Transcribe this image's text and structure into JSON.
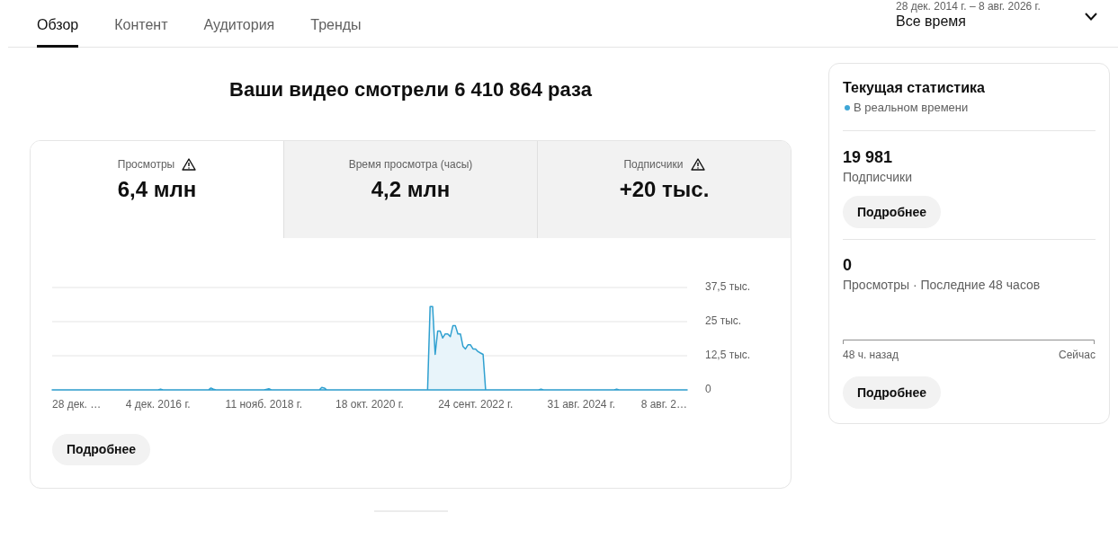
{
  "tabs": [
    {
      "label": "Обзор",
      "selected": true
    },
    {
      "label": "Контент",
      "selected": false
    },
    {
      "label": "Аудитория",
      "selected": false
    },
    {
      "label": "Тренды",
      "selected": false
    }
  ],
  "date_range": {
    "range": "28 дек. 2014 г. – 8 авг. 2026 г.",
    "period": "Все время"
  },
  "headline": "Ваши видео смотрели 6 410 864 раза",
  "overview_card": {
    "metrics": [
      {
        "label": "Просмотры",
        "value": "6,4 млн",
        "warning": true,
        "selected": true
      },
      {
        "label": "Время просмотра (часы)",
        "value": "4,2 млн",
        "warning": false,
        "selected": false
      },
      {
        "label": "Подписчики",
        "value": "+20 тыс.",
        "warning": true,
        "selected": false
      }
    ],
    "chart_data": {
      "type": "area",
      "categories": [
        "28 дек. …",
        null,
        null,
        null,
        null,
        null,
        null,
        null,
        null,
        null,
        null,
        null,
        null,
        null,
        null,
        null,
        null,
        null,
        null,
        null,
        null,
        null,
        null,
        null,
        null,
        null,
        null,
        null,
        null,
        null,
        null,
        null,
        null,
        null,
        null,
        null,
        null,
        null,
        null,
        null,
        null,
        null,
        "4 дек. 2016 г.",
        null,
        null,
        null,
        null,
        null,
        null,
        null,
        null,
        null,
        null,
        null,
        null,
        null,
        null,
        null,
        null,
        null,
        null,
        null,
        null,
        null,
        null,
        null,
        null,
        null,
        null,
        null,
        null,
        null,
        null,
        null,
        null,
        null,
        null,
        null,
        null,
        null,
        null,
        null,
        null,
        null,
        "11 нояб. 2018 г.",
        null,
        null,
        null,
        null,
        null,
        null,
        null,
        null,
        null,
        null,
        null,
        null,
        null,
        null,
        null,
        null,
        null,
        null,
        null,
        null,
        null,
        null,
        null,
        null,
        null,
        null,
        null,
        null,
        null,
        null,
        null,
        null,
        null,
        null,
        null,
        null,
        null,
        null,
        null,
        null,
        null,
        "18 окт. 2020 г.",
        null,
        null,
        null,
        null,
        null,
        null,
        null,
        null,
        null,
        null,
        null,
        null,
        null,
        null,
        null,
        null,
        null,
        null,
        null,
        null,
        null,
        null,
        null,
        null,
        null,
        null,
        null,
        null,
        null,
        null,
        null,
        null,
        null,
        null,
        null,
        null,
        null,
        null,
        null,
        null,
        null,
        "24 сент. 2022 г.",
        null,
        null,
        null,
        null,
        null,
        null,
        null,
        null,
        null,
        null,
        null,
        null,
        null,
        null,
        null,
        null,
        null,
        null,
        null,
        null,
        null,
        null,
        null,
        null,
        null,
        null,
        null,
        null,
        null,
        null,
        null,
        null,
        null,
        null,
        null,
        null,
        null,
        null,
        null,
        null,
        null,
        "31 авг. 2024 г.",
        null,
        null,
        null,
        null,
        null,
        null,
        null,
        null,
        null,
        null,
        null,
        null,
        null,
        null,
        null,
        null,
        null,
        null,
        null,
        null,
        null,
        null,
        null,
        null,
        null,
        null,
        null,
        null,
        null,
        null,
        null,
        null,
        null,
        null,
        null,
        null,
        null,
        null,
        null,
        null,
        null,
        "8 авг. 2…"
      ],
      "values": [
        0,
        0,
        0,
        0,
        0,
        0,
        0,
        0,
        0,
        0,
        0,
        0,
        0,
        0,
        0,
        0,
        0,
        0,
        0,
        0,
        0,
        0,
        0,
        0,
        0,
        0,
        0,
        0,
        0,
        0,
        0,
        0,
        0,
        0,
        0,
        0,
        0,
        0,
        0,
        0,
        0,
        0,
        0,
        0.3,
        0,
        0,
        0,
        0,
        0,
        0,
        0,
        0,
        0,
        0,
        0,
        0,
        0,
        0,
        0,
        0,
        0,
        0,
        0,
        0.7,
        0.3,
        0,
        0,
        0,
        0,
        0,
        0,
        0,
        0,
        0,
        0,
        0,
        0,
        0,
        0,
        0,
        0,
        0,
        0,
        0,
        0,
        0.2,
        0.4,
        0,
        0,
        0,
        0,
        0,
        0,
        0,
        0,
        0,
        0,
        0,
        0,
        0,
        0,
        0,
        0,
        0,
        0,
        0,
        0,
        0.9,
        0.7,
        0,
        0,
        0,
        0,
        0,
        0,
        0,
        0,
        0,
        0,
        0,
        0,
        0,
        0,
        0,
        0,
        0,
        0,
        0,
        0,
        0,
        0,
        0,
        0,
        0,
        0,
        0,
        0,
        0,
        0,
        0,
        0,
        0,
        0,
        0,
        0,
        0,
        0,
        0,
        0,
        0,
        30.5,
        30.5,
        13,
        21.5,
        21.5,
        19,
        20.5,
        20.5,
        19.5,
        23.5,
        23.5,
        20.5,
        20.5,
        16,
        15,
        16.5,
        16.5,
        15,
        15,
        14,
        13.5,
        13,
        0,
        0,
        0,
        0,
        0,
        0,
        0,
        0,
        0,
        0,
        0,
        0,
        0,
        0,
        0,
        0,
        0,
        0,
        0,
        0,
        0,
        0,
        0.3,
        0,
        0,
        0,
        0,
        0,
        0,
        0,
        0,
        0,
        0,
        0,
        0,
        0,
        0,
        0,
        0,
        0,
        0,
        0,
        0,
        0,
        0,
        0,
        0,
        0,
        0,
        0,
        0,
        0,
        0.3,
        0,
        0,
        0,
        0,
        0,
        0,
        0,
        0,
        0,
        0,
        0,
        0,
        0,
        0,
        0,
        0,
        0,
        0,
        0,
        0,
        0,
        0,
        0,
        0,
        0,
        0,
        0,
        0
      ],
      "ylim": [
        0,
        37.5
      ],
      "yticks": [
        {
          "value": 0,
          "label": "0"
        },
        {
          "value": 12.5,
          "label": "12,5 тыс."
        },
        {
          "value": 25,
          "label": "25 тыс."
        },
        {
          "value": 37.5,
          "label": "37,5 тыс."
        }
      ]
    },
    "button": "Подробнее"
  },
  "realtime": {
    "title": "Текущая статистика",
    "live_label": "В реальном времени",
    "stats": [
      {
        "kind": "plain",
        "value": "19 981",
        "label": "Подписчики",
        "button": "Подробнее"
      },
      {
        "kind": "chart",
        "value": "0",
        "label": "Просмотры · Последние 48 часов",
        "axis_start": "48 ч. назад",
        "axis_end": "Сейчас",
        "button": "Подробнее"
      }
    ]
  }
}
